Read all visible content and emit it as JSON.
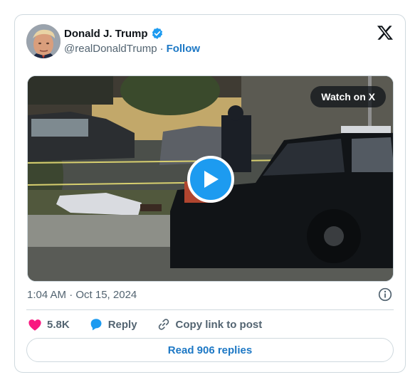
{
  "author": {
    "display_name": "Donald J. Trump",
    "handle": "@realDonaldTrump",
    "separator": "·",
    "follow_label": "Follow",
    "verified": true
  },
  "media": {
    "watch_label": "Watch on X"
  },
  "meta": {
    "timestamp": "1:04 AM · Oct 15, 2024"
  },
  "actions": {
    "likes_count": "5.8K",
    "reply_label": "Reply",
    "copy_label": "Copy link to post"
  },
  "footer": {
    "read_replies_label": "Read 906 replies"
  },
  "colors": {
    "accent": "#1d9bf0",
    "link": "#1d78c5",
    "like": "#f91880",
    "muted": "#536471",
    "border": "#cfd9de"
  },
  "icons": [
    "verified-badge-icon",
    "x-logo-icon",
    "play-icon",
    "info-icon",
    "heart-icon",
    "reply-icon",
    "link-icon"
  ]
}
